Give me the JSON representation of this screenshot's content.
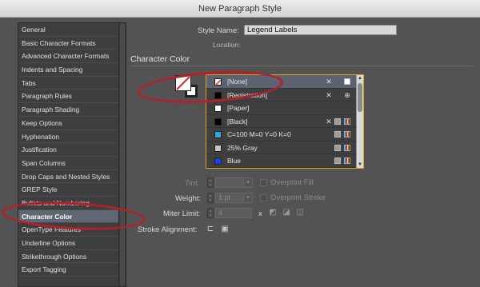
{
  "window": {
    "title": "New Paragraph Style"
  },
  "sidebar": {
    "items": [
      {
        "label": "General"
      },
      {
        "label": "Basic Character Formats"
      },
      {
        "label": "Advanced Character Formats"
      },
      {
        "label": "Indents and Spacing"
      },
      {
        "label": "Tabs"
      },
      {
        "label": "Paragraph Rules"
      },
      {
        "label": "Paragraph Shading"
      },
      {
        "label": "Keep Options"
      },
      {
        "label": "Hyphenation"
      },
      {
        "label": "Justification"
      },
      {
        "label": "Span Columns"
      },
      {
        "label": "Drop Caps and Nested Styles"
      },
      {
        "label": "GREP Style"
      },
      {
        "label": "Bullets and Numbering"
      },
      {
        "label": "Character Color",
        "selected": true
      },
      {
        "label": "OpenType Features"
      },
      {
        "label": "Underline Options"
      },
      {
        "label": "Strikethrough Options"
      },
      {
        "label": "Export Tagging"
      }
    ]
  },
  "header": {
    "style_name_label": "Style Name:",
    "style_name_value": "Legend Labels",
    "location_label": "Location:"
  },
  "section": {
    "title": "Character Color"
  },
  "swatches": [
    {
      "name": "[None]",
      "color": "#ffffff",
      "selected": true
    },
    {
      "name": "[Registration]",
      "color": "#000000"
    },
    {
      "name": "[Paper]",
      "color": "#ffffff"
    },
    {
      "name": "[Black]",
      "color": "#000000"
    },
    {
      "name": "C=100 M=0 Y=0 K=0",
      "color": "#29abe2"
    },
    {
      "name": "25% Gray",
      "color": "#c8c8c8"
    },
    {
      "name": "Blue",
      "color": "#1d3fe0"
    }
  ],
  "controls": {
    "tint_label": "Tint:",
    "overprint_fill_label": "Overprint Fill",
    "weight_label": "Weight:",
    "weight_value": "1 pt",
    "overprint_stroke_label": "Overprint Stroke",
    "miter_label": "Miter Limit:",
    "miter_value": "4",
    "miter_unit": "x",
    "stroke_alignment_label": "Stroke Alignment:"
  },
  "colors": {
    "selection": "#5f6773",
    "annotation": "#b3202b",
    "list_border": "#e2a021"
  }
}
